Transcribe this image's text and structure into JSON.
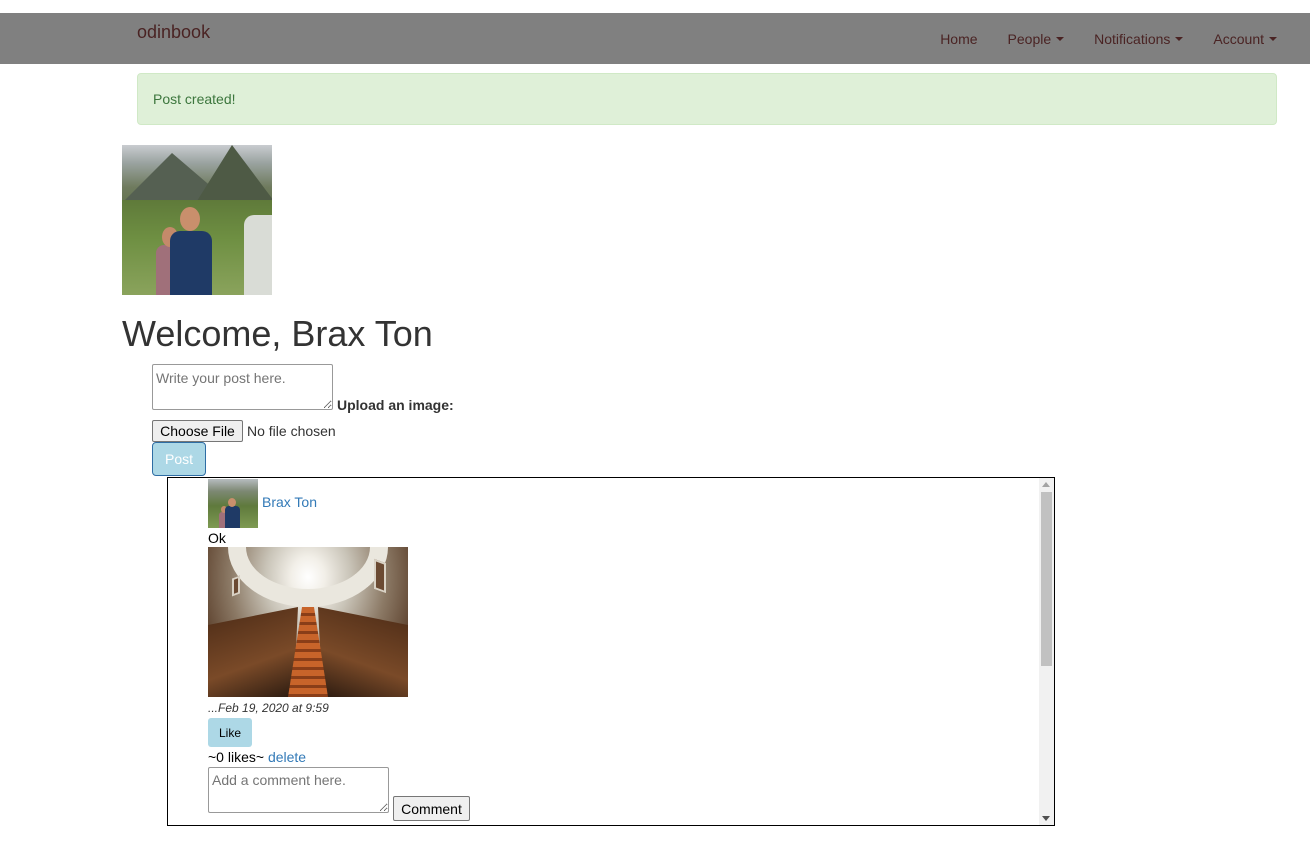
{
  "navbar": {
    "brand": "odinbook",
    "links": [
      {
        "label": "Home",
        "dropdown": false
      },
      {
        "label": "People",
        "dropdown": true
      },
      {
        "label": "Notifications",
        "dropdown": true
      },
      {
        "label": "Account",
        "dropdown": true
      }
    ]
  },
  "alert": {
    "text": "Post created!"
  },
  "welcome": "Welcome, Brax Ton",
  "post_form": {
    "textarea_placeholder": "Write your post here.",
    "upload_label": "Upload an image:",
    "choose_file_label": "Choose File",
    "file_status": "No file chosen",
    "post_button": "Post"
  },
  "feed": {
    "posts": [
      {
        "author": "Brax Ton",
        "text": "Ok",
        "timestamp": "...Feb 19, 2020 at 9:59",
        "like_label": "Like",
        "likes_text": "~0 likes~",
        "delete_label": "delete",
        "comment_placeholder": "Add a comment here.",
        "comment_button": "Comment"
      }
    ]
  },
  "colors": {
    "navbar_bg": "#808080",
    "alert_bg": "#dff0d8",
    "alert_text": "#3c763d",
    "link": "#337ab7",
    "button_light_blue": "#add8e6"
  }
}
